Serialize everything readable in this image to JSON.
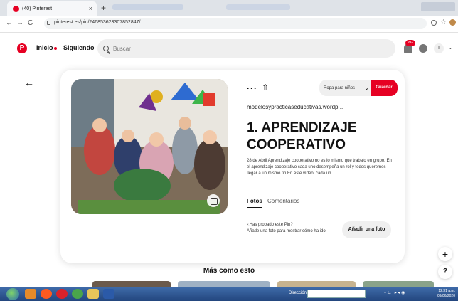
{
  "browser": {
    "tab_title": "(40) Pinterest",
    "tab_close": "×",
    "new_tab": "+",
    "url": "pinterest.es/pin/246853623307852847/",
    "back_arrow": "←",
    "forward_arrow": "→",
    "reload": "C"
  },
  "header": {
    "logo": "P",
    "nav_home": "Inicio",
    "nav_following": "Siguiendo",
    "search_placeholder": "Buscar",
    "notification_badge": "99+",
    "avatar_initial": "T",
    "account_chevron": "⌄"
  },
  "pin": {
    "back_arrow": "←",
    "more_options": "···",
    "share": "⇧",
    "board_name": "Ropa para niños",
    "board_chevron": "⌄",
    "save_label": "Guardar",
    "source_link": "modelosypracticaseducativas.wordp...",
    "title": "1. APRENDIZAJE COOPERATIVO",
    "description": "28 de Abril Aprendizaje cooperativo no es lo mismo que trabajo en grupo. En el aprendizaje cooperativo cada uno desempeña un rol y todos queremos llegar a un mismo fin En este vídeo, cada un...",
    "tab_photos": "Fotos",
    "tab_comments": "Comentarios",
    "tried_question": "¿Has probado este Pin?",
    "tried_subtext": "Añade una foto para mostrar cómo ha ido",
    "add_photo_label": "Añadir una foto"
  },
  "floating": {
    "plus": "+",
    "help": "?"
  },
  "more_like_this": "Más como esto",
  "taskbar": {
    "address_label": "Dirección",
    "clock_time": "12:31 a.m.",
    "clock_date": "09/06/2020"
  },
  "colors": {
    "brand_red": "#e60023",
    "taskbar_blue": "#2d5590"
  }
}
